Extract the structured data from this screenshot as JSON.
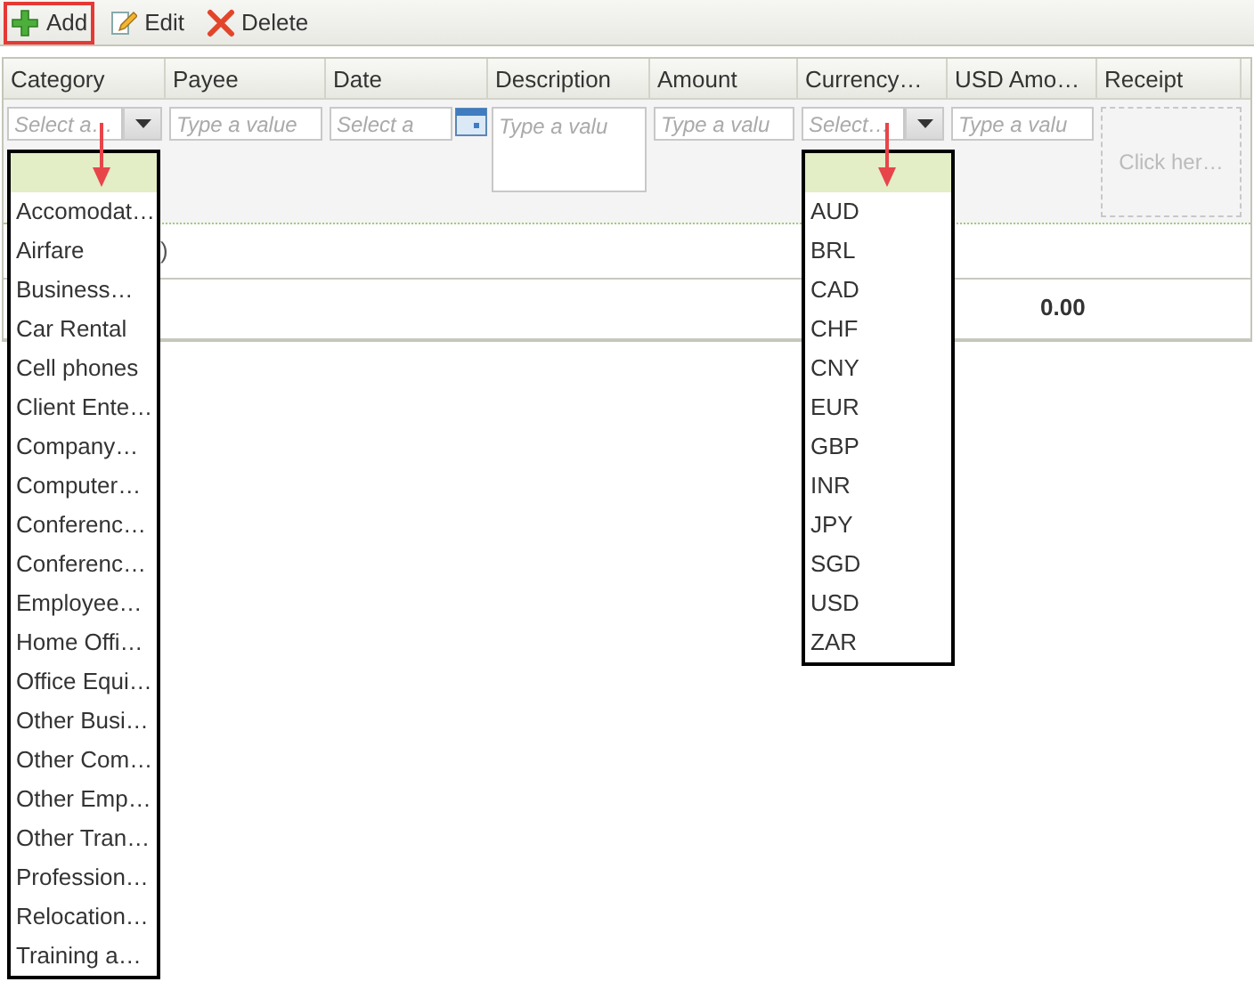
{
  "toolbar": {
    "buttons": [
      {
        "label": "Add",
        "kind": "add",
        "highlighted": true
      },
      {
        "label": "Edit",
        "kind": "edit",
        "highlighted": false
      },
      {
        "label": "Delete",
        "kind": "delete",
        "highlighted": false
      }
    ]
  },
  "grid": {
    "columns": [
      "Category",
      "Payee",
      "Date",
      "Description",
      "Amount",
      "Currency…",
      "USD Amo…",
      "Receipt"
    ],
    "insert_row": [
      {
        "kind": "select",
        "placeholder": "Select a…",
        "dropdown": {
          "pointer": true,
          "items": [
            "Accomodat…",
            "Airfare",
            "Business…",
            "Car Rental",
            "Cell phones",
            "Client Ente…",
            "Company…",
            "Computer…",
            "Conferenc…",
            "Conferenc…",
            "Employee…",
            "Home Offi…",
            "Office Equi…",
            "Other Busi…",
            "Other Com…",
            "Other Emp…",
            "Other Tran…",
            "Profession…",
            "Relocation…",
            "Training a…"
          ]
        }
      },
      {
        "kind": "text",
        "placeholder": "Type a value"
      },
      {
        "kind": "date",
        "placeholder": "Select a"
      },
      {
        "kind": "textarea",
        "placeholder": "Type a valu"
      },
      {
        "kind": "text",
        "placeholder": "Type a valu"
      },
      {
        "kind": "select",
        "placeholder": "Select…",
        "dropdown": {
          "pointer": true,
          "items": [
            "AUD",
            "BRL",
            "CAD",
            "CHF",
            "CNY",
            "EUR",
            "GBP",
            "INR",
            "JPY",
            "SGD",
            "USD",
            "ZAR"
          ]
        }
      },
      {
        "kind": "text",
        "placeholder": "Type a valu"
      },
      {
        "kind": "upload",
        "placeholder": "Click her…"
      }
    ],
    "row": {
      "column_1": ")"
    },
    "footer": {
      "usd_amount_total": "0.00"
    }
  }
}
